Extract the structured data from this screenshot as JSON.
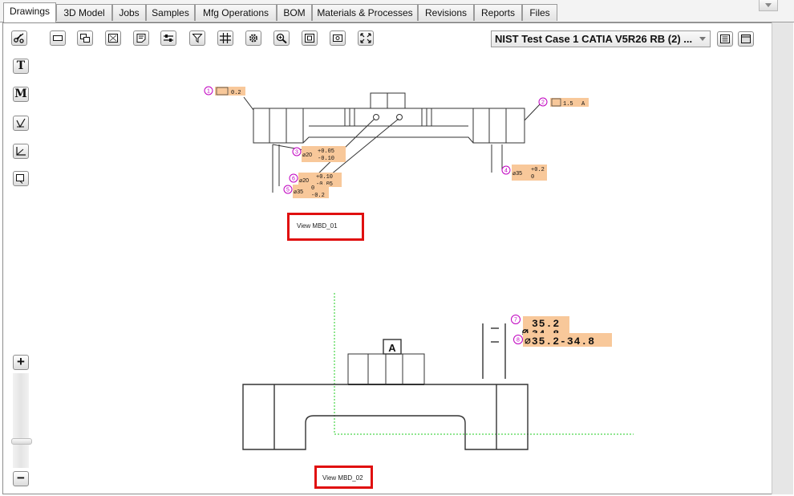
{
  "tabs": [
    {
      "label": "Drawings",
      "active": true
    },
    {
      "label": "3D Model"
    },
    {
      "label": "Jobs"
    },
    {
      "label": "Samples"
    },
    {
      "label": "Mfg Operations"
    },
    {
      "label": "BOM"
    },
    {
      "label": "Materials & Processes"
    },
    {
      "label": "Revisions"
    },
    {
      "label": "Reports"
    },
    {
      "label": "Files"
    }
  ],
  "drawing_select": {
    "value": "NIST Test Case 1 CATIA V5R26 RB (2) ..."
  },
  "left_tools": {
    "text_tool": "T",
    "mtext_tool": "M"
  },
  "zoom": {
    "plus": "+",
    "minus": "−"
  },
  "views": {
    "view1": {
      "label": "View MBD_01"
    },
    "view2": {
      "label": "View MBD_02"
    }
  },
  "callouts": {
    "c1": {
      "num": "1",
      "value": "0.2"
    },
    "c2": {
      "num": "2",
      "value": "1.5",
      "datum": "A"
    },
    "c3": {
      "num": "3",
      "dia": "⌀20",
      "plus": "+0.05",
      "minus": "-0.10"
    },
    "c4": {
      "num": "4",
      "dia": "⌀35",
      "plus": "+0.2",
      "minus": "0"
    },
    "c5": {
      "num": "5",
      "dia": "⌀35",
      "plus": "0",
      "minus": "-0.2"
    },
    "c6": {
      "num": "6",
      "dia": "⌀20",
      "plus": "+0.10",
      "minus": "-0.05"
    },
    "c7": {
      "num": "7",
      "upper": "35.2",
      "lower": "34.8"
    },
    "c8": {
      "num": "8",
      "range": "⌀35.2-34.8"
    },
    "datum_a": "A"
  },
  "colors": {
    "highlight": "#f8c89a",
    "callout": "#c000c0",
    "center_line": "#22cc22",
    "red_box": "#e01010"
  }
}
